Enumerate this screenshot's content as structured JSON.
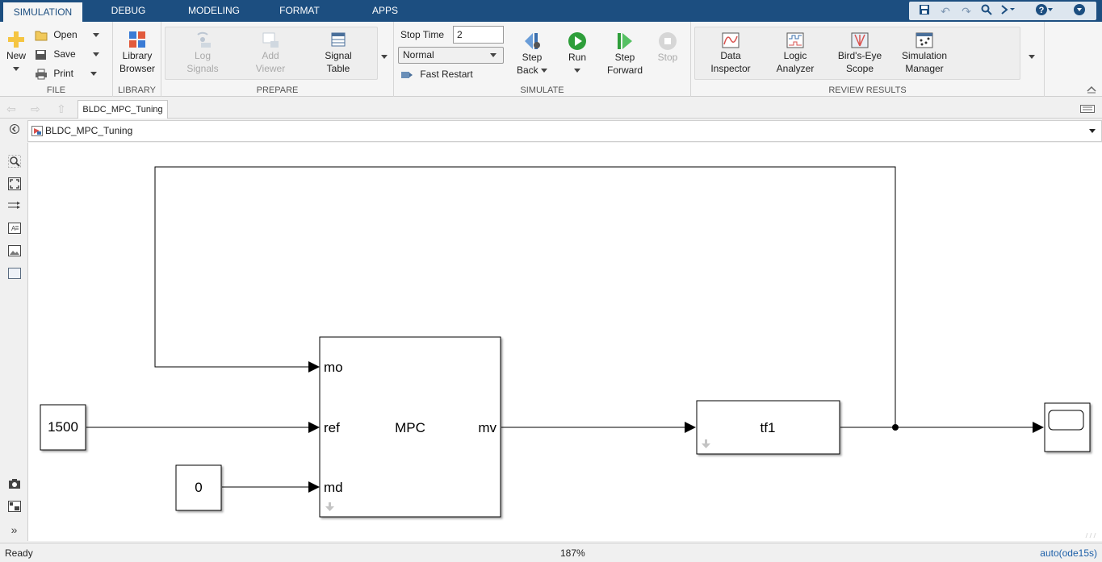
{
  "tabs": [
    "SIMULATION",
    "DEBUG",
    "MODELING",
    "FORMAT",
    "APPS"
  ],
  "ribbon": {
    "file": {
      "title": "FILE",
      "new": "New",
      "open": "Open",
      "save": "Save",
      "print": "Print"
    },
    "library": {
      "title": "LIBRARY",
      "browser_l1": "Library",
      "browser_l2": "Browser"
    },
    "prepare": {
      "title": "PREPARE",
      "log_l1": "Log",
      "log_l2": "Signals",
      "viewer_l1": "Add",
      "viewer_l2": "Viewer",
      "table_l1": "Signal",
      "table_l2": "Table"
    },
    "simulate": {
      "title": "SIMULATE",
      "stop_time_label": "Stop Time",
      "stop_time_value": "2",
      "mode": "Normal",
      "fast_restart": "Fast Restart",
      "step_back_l1": "Step",
      "step_back_l2": "Back",
      "run": "Run",
      "step_fwd_l1": "Step",
      "step_fwd_l2": "Forward",
      "stop": "Stop"
    },
    "review": {
      "title": "REVIEW RESULTS",
      "data_l1": "Data",
      "data_l2": "Inspector",
      "logic_l1": "Logic",
      "logic_l2": "Analyzer",
      "bird_l1": "Bird's-Eye",
      "bird_l2": "Scope",
      "simman_l1": "Simulation",
      "simman_l2": "Manager"
    }
  },
  "model_tab": "BLDC_MPC_Tuning",
  "breadcrumb": "BLDC_MPC_Tuning",
  "diagram": {
    "const1500": "1500",
    "const0": "0",
    "mpc_label": "MPC",
    "mpc_in_mo": "mo",
    "mpc_in_ref": "ref",
    "mpc_in_md": "md",
    "mpc_out_mv": "mv",
    "tf_label": "tf1"
  },
  "status": {
    "left": "Ready",
    "zoom": "187%",
    "solver": "auto(ode15s)"
  },
  "colors": {
    "accent": "#1c4e80",
    "run_green": "#2e9e3a"
  }
}
